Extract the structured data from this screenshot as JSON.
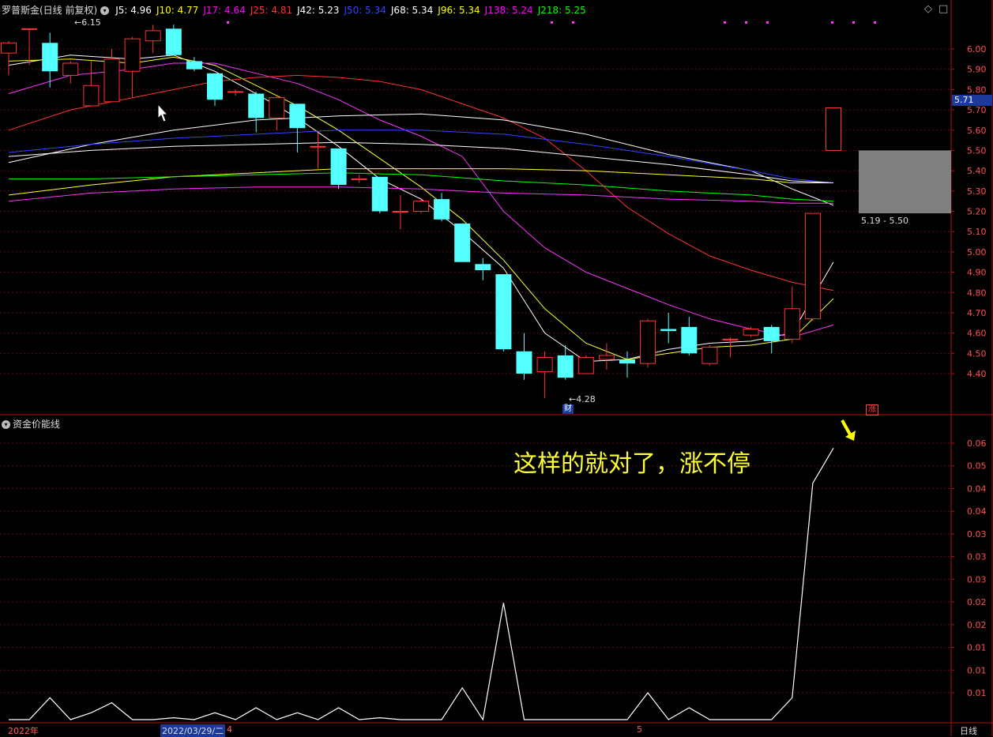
{
  "header": {
    "title": "罗普斯金(日线 前复权)",
    "ma_labels": [
      {
        "text": "J5: 4.96",
        "color": "#ffffff"
      },
      {
        "text": "J10: 4.77",
        "color": "#ffff00"
      },
      {
        "text": "J17: 4.64",
        "color": "#ff00ff"
      },
      {
        "text": "J25: 4.81",
        "color": "#ff3333"
      },
      {
        "text": "J42: 5.23",
        "color": "#ffffff"
      },
      {
        "text": "J50: 5.34",
        "color": "#3344ff"
      },
      {
        "text": "J68: 5.34",
        "color": "#ffffff"
      },
      {
        "text": "J96: 5.34",
        "color": "#ffff00"
      },
      {
        "text": "J138: 5.24",
        "color": "#ff00ff"
      },
      {
        "text": "J218: 5.25",
        "color": "#00ff00"
      }
    ]
  },
  "controls": {
    "diamond_icon": "◇",
    "square_icon": "□"
  },
  "price_axis": {
    "ticks": [
      "6.00",
      "5.90",
      "5.80",
      "5.70",
      "5.60",
      "5.50",
      "5.40",
      "5.30",
      "5.20",
      "5.10",
      "5.00",
      "4.90",
      "4.80",
      "4.70",
      "4.60",
      "4.50",
      "4.40"
    ],
    "current": "5.71"
  },
  "annotations": {
    "high": "6.15",
    "low": "4.28",
    "range": "5.19 - 5.50",
    "badge_cai": "财",
    "badge_zhang": "涨",
    "comment": "这样的就对了，涨不停"
  },
  "indicator": {
    "name": "资金价能线",
    "ticks": [
      "0.06",
      "0.05",
      "0.04",
      "0.04",
      "0.03",
      "0.03",
      "0.03",
      "0.02",
      "0.02",
      "0.01",
      "0.01",
      "0.01"
    ]
  },
  "footer": {
    "year": "2022年",
    "selected_date": "2022/03/29/二",
    "month_4": "4",
    "month_5": "5",
    "period": "日线"
  },
  "colors": {
    "up": "#ff3333",
    "down": "#54ffff",
    "frame": "#b01010",
    "grid": "#5a0c0c"
  },
  "chart_data": {
    "type": "candlestick",
    "price_range": [
      4.3,
      6.12
    ],
    "candles": [
      {
        "o": 5.98,
        "h": 6.04,
        "l": 5.87,
        "c": 6.03
      },
      {
        "o": 6.1,
        "h": 6.1,
        "l": 5.92,
        "c": 6.1
      },
      {
        "o": 6.03,
        "h": 6.08,
        "l": 5.81,
        "c": 5.89
      },
      {
        "o": 5.87,
        "h": 5.94,
        "l": 5.83,
        "c": 5.93
      },
      {
        "o": 5.72,
        "h": 5.94,
        "l": 5.72,
        "c": 5.82
      },
      {
        "o": 5.74,
        "h": 6.0,
        "l": 5.74,
        "c": 5.95
      },
      {
        "o": 5.89,
        "h": 6.06,
        "l": 5.76,
        "c": 6.05
      },
      {
        "o": 6.04,
        "h": 6.12,
        "l": 5.98,
        "c": 6.09
      },
      {
        "o": 6.1,
        "h": 6.12,
        "l": 5.97,
        "c": 5.97
      },
      {
        "o": 5.94,
        "h": 5.96,
        "l": 5.89,
        "c": 5.9
      },
      {
        "o": 5.88,
        "h": 5.88,
        "l": 5.72,
        "c": 5.75
      },
      {
        "o": 5.79,
        "h": 5.8,
        "l": 5.77,
        "c": 5.79
      },
      {
        "o": 5.78,
        "h": 5.79,
        "l": 5.59,
        "c": 5.66
      },
      {
        "o": 5.66,
        "h": 5.77,
        "l": 5.6,
        "c": 5.76
      },
      {
        "o": 5.73,
        "h": 5.73,
        "l": 5.49,
        "c": 5.61
      },
      {
        "o": 5.52,
        "h": 5.59,
        "l": 5.41,
        "c": 5.52
      },
      {
        "o": 5.51,
        "h": 5.51,
        "l": 5.31,
        "c": 5.33
      },
      {
        "o": 5.36,
        "h": 5.38,
        "l": 5.34,
        "c": 5.36
      },
      {
        "o": 5.37,
        "h": 5.37,
        "l": 5.19,
        "c": 5.2
      },
      {
        "o": 5.2,
        "h": 5.28,
        "l": 5.11,
        "c": 5.2
      },
      {
        "o": 5.2,
        "h": 5.26,
        "l": 5.19,
        "c": 5.25
      },
      {
        "o": 5.26,
        "h": 5.29,
        "l": 5.15,
        "c": 5.16
      },
      {
        "o": 5.14,
        "h": 5.14,
        "l": 4.95,
        "c": 4.95
      },
      {
        "o": 4.94,
        "h": 4.97,
        "l": 4.86,
        "c": 4.91
      },
      {
        "o": 4.89,
        "h": 4.89,
        "l": 4.51,
        "c": 4.52
      },
      {
        "o": 4.51,
        "h": 4.6,
        "l": 4.37,
        "c": 4.4
      },
      {
        "o": 4.41,
        "h": 4.51,
        "l": 4.28,
        "c": 4.48
      },
      {
        "o": 4.49,
        "h": 4.54,
        "l": 4.37,
        "c": 4.38
      },
      {
        "o": 4.4,
        "h": 4.49,
        "l": 4.4,
        "c": 4.48
      },
      {
        "o": 4.47,
        "h": 4.55,
        "l": 4.42,
        "c": 4.49
      },
      {
        "o": 4.47,
        "h": 4.51,
        "l": 4.38,
        "c": 4.45
      },
      {
        "o": 4.45,
        "h": 4.67,
        "l": 4.43,
        "c": 4.66
      },
      {
        "o": 4.62,
        "h": 4.7,
        "l": 4.55,
        "c": 4.61
      },
      {
        "o": 4.63,
        "h": 4.68,
        "l": 4.49,
        "c": 4.5
      },
      {
        "o": 4.45,
        "h": 4.54,
        "l": 4.44,
        "c": 4.53
      },
      {
        "o": 4.57,
        "h": 4.58,
        "l": 4.48,
        "c": 4.57
      },
      {
        "o": 4.59,
        "h": 4.63,
        "l": 4.58,
        "c": 4.62
      },
      {
        "o": 4.63,
        "h": 4.64,
        "l": 4.5,
        "c": 4.56
      },
      {
        "o": 4.57,
        "h": 4.83,
        "l": 4.55,
        "c": 4.72
      },
      {
        "o": 4.67,
        "h": 5.19,
        "l": 4.66,
        "c": 5.19
      },
      {
        "o": 5.5,
        "h": 5.71,
        "l": 5.5,
        "c": 5.71
      }
    ],
    "ma_lines": [
      {
        "name": "J5",
        "color": "#ffffff",
        "pts": [
          [
            0,
            5.92
          ],
          [
            3,
            5.97
          ],
          [
            6,
            5.95
          ],
          [
            8,
            5.97
          ],
          [
            10,
            5.89
          ],
          [
            12,
            5.78
          ],
          [
            14,
            5.66
          ],
          [
            16,
            5.52
          ],
          [
            18,
            5.36
          ],
          [
            20,
            5.26
          ],
          [
            22,
            5.1
          ],
          [
            24,
            4.92
          ],
          [
            26,
            4.6
          ],
          [
            28,
            4.46
          ],
          [
            30,
            4.47
          ],
          [
            32,
            4.52
          ],
          [
            34,
            4.55
          ],
          [
            36,
            4.56
          ],
          [
            38,
            4.6
          ],
          [
            40,
            4.95
          ]
        ]
      },
      {
        "name": "J10",
        "color": "#ffff33",
        "pts": [
          [
            0,
            5.94
          ],
          [
            3,
            5.95
          ],
          [
            6,
            5.93
          ],
          [
            8,
            5.96
          ],
          [
            10,
            5.92
          ],
          [
            12,
            5.82
          ],
          [
            14,
            5.72
          ],
          [
            16,
            5.6
          ],
          [
            18,
            5.46
          ],
          [
            20,
            5.32
          ],
          [
            22,
            5.16
          ],
          [
            24,
            4.96
          ],
          [
            26,
            4.72
          ],
          [
            28,
            4.55
          ],
          [
            30,
            4.47
          ],
          [
            32,
            4.5
          ],
          [
            34,
            4.53
          ],
          [
            36,
            4.54
          ],
          [
            38,
            4.57
          ],
          [
            40,
            4.77
          ]
        ]
      },
      {
        "name": "J17",
        "color": "#ff33ff",
        "pts": [
          [
            0,
            5.78
          ],
          [
            3,
            5.87
          ],
          [
            6,
            5.9
          ],
          [
            8,
            5.93
          ],
          [
            10,
            5.93
          ],
          [
            12,
            5.88
          ],
          [
            14,
            5.83
          ],
          [
            16,
            5.75
          ],
          [
            18,
            5.65
          ],
          [
            20,
            5.57
          ],
          [
            22,
            5.47
          ],
          [
            24,
            5.2
          ],
          [
            26,
            5.02
          ],
          [
            28,
            4.9
          ],
          [
            30,
            4.82
          ],
          [
            32,
            4.74
          ],
          [
            34,
            4.67
          ],
          [
            36,
            4.62
          ],
          [
            38,
            4.58
          ],
          [
            40,
            4.64
          ]
        ]
      },
      {
        "name": "J25",
        "color": "#ff3333",
        "pts": [
          [
            0,
            5.6
          ],
          [
            3,
            5.7
          ],
          [
            6,
            5.76
          ],
          [
            8,
            5.8
          ],
          [
            10,
            5.84
          ],
          [
            12,
            5.86
          ],
          [
            14,
            5.87
          ],
          [
            16,
            5.86
          ],
          [
            18,
            5.84
          ],
          [
            20,
            5.8
          ],
          [
            22,
            5.73
          ],
          [
            24,
            5.66
          ],
          [
            26,
            5.56
          ],
          [
            28,
            5.4
          ],
          [
            30,
            5.22
          ],
          [
            32,
            5.09
          ],
          [
            34,
            4.98
          ],
          [
            36,
            4.91
          ],
          [
            38,
            4.85
          ],
          [
            40,
            4.81
          ]
        ]
      },
      {
        "name": "J42",
        "color": "#ffffff",
        "pts": [
          [
            0,
            5.44
          ],
          [
            4,
            5.53
          ],
          [
            8,
            5.6
          ],
          [
            12,
            5.65
          ],
          [
            16,
            5.67
          ],
          [
            20,
            5.68
          ],
          [
            24,
            5.65
          ],
          [
            28,
            5.58
          ],
          [
            32,
            5.48
          ],
          [
            36,
            5.4
          ],
          [
            38,
            5.31
          ],
          [
            40,
            5.23
          ]
        ]
      },
      {
        "name": "J50",
        "color": "#3344ff",
        "pts": [
          [
            0,
            5.49
          ],
          [
            4,
            5.53
          ],
          [
            8,
            5.56
          ],
          [
            12,
            5.58
          ],
          [
            16,
            5.6
          ],
          [
            20,
            5.6
          ],
          [
            24,
            5.58
          ],
          [
            28,
            5.53
          ],
          [
            32,
            5.47
          ],
          [
            36,
            5.4
          ],
          [
            38,
            5.36
          ],
          [
            40,
            5.34
          ]
        ]
      },
      {
        "name": "J68",
        "color": "#ffffff",
        "pts": [
          [
            0,
            5.47
          ],
          [
            4,
            5.5
          ],
          [
            8,
            5.52
          ],
          [
            12,
            5.53
          ],
          [
            16,
            5.54
          ],
          [
            20,
            5.53
          ],
          [
            24,
            5.51
          ],
          [
            28,
            5.47
          ],
          [
            32,
            5.43
          ],
          [
            36,
            5.38
          ],
          [
            38,
            5.35
          ],
          [
            40,
            5.34
          ]
        ]
      },
      {
        "name": "J96",
        "color": "#ffff33",
        "pts": [
          [
            0,
            5.28
          ],
          [
            4,
            5.33
          ],
          [
            8,
            5.37
          ],
          [
            12,
            5.39
          ],
          [
            16,
            5.41
          ],
          [
            20,
            5.41
          ],
          [
            24,
            5.41
          ],
          [
            28,
            5.4
          ],
          [
            32,
            5.38
          ],
          [
            36,
            5.36
          ],
          [
            38,
            5.34
          ],
          [
            40,
            5.34
          ]
        ]
      },
      {
        "name": "J138",
        "color": "#ff33ff",
        "pts": [
          [
            0,
            5.25
          ],
          [
            4,
            5.29
          ],
          [
            8,
            5.31
          ],
          [
            12,
            5.32
          ],
          [
            16,
            5.32
          ],
          [
            20,
            5.31
          ],
          [
            24,
            5.29
          ],
          [
            28,
            5.28
          ],
          [
            32,
            5.26
          ],
          [
            36,
            5.25
          ],
          [
            38,
            5.24
          ],
          [
            40,
            5.24
          ]
        ]
      },
      {
        "name": "J218",
        "color": "#00ff00",
        "pts": [
          [
            0,
            5.36
          ],
          [
            4,
            5.36
          ],
          [
            8,
            5.37
          ],
          [
            12,
            5.38
          ],
          [
            16,
            5.39
          ],
          [
            20,
            5.38
          ],
          [
            24,
            5.35
          ],
          [
            28,
            5.33
          ],
          [
            32,
            5.3
          ],
          [
            36,
            5.28
          ],
          [
            38,
            5.26
          ],
          [
            40,
            5.25
          ]
        ]
      }
    ],
    "range_box": [
      5.19,
      5.5
    ],
    "indicator_range": [
      0.0,
      0.065
    ],
    "indicator_values": [
      0.001,
      0.003,
      0.009,
      0.002,
      0.006,
      0.008,
      0.004,
      0.003,
      0.005,
      0.004,
      0.006,
      0.003,
      0.007,
      0.004,
      0.006,
      0.002,
      0.007,
      0.002,
      0.005,
      0.001,
      0.002,
      0.003,
      0.011,
      0.001,
      0.028,
      0.004,
      0.003,
      0.004,
      0.004,
      0.002,
      0.001,
      0.01,
      0.002,
      0.007,
      0.002,
      0.002,
      0.002,
      0.003,
      0.009,
      0.052,
      0.059
    ]
  }
}
